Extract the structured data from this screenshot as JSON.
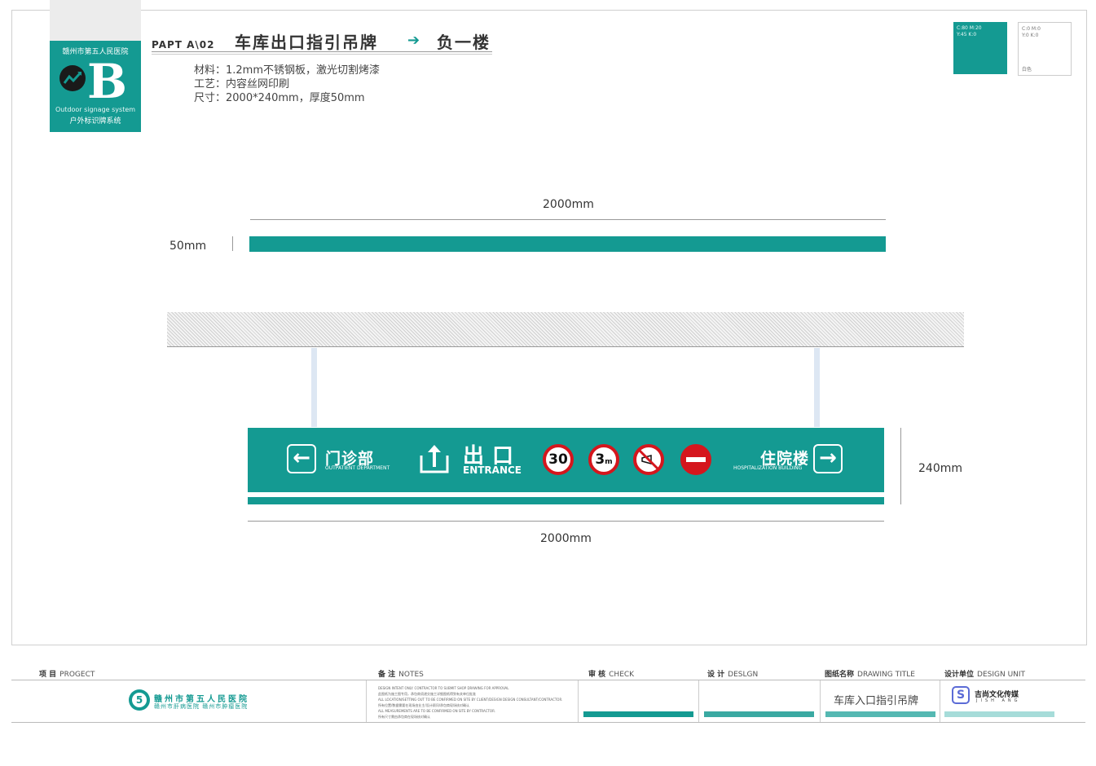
{
  "logo": {
    "hospital": "赣州市第五人民医院",
    "letter": "B",
    "system_en": "Outdoor signage system",
    "system_cn": "户外标识牌系统"
  },
  "header": {
    "part": "PAPT  A\\02",
    "title": "车库出口指引吊牌",
    "floor": "负一楼",
    "specs": [
      "材料：1.2mm不锈钢板，激光切割烤漆",
      "工艺：内容丝网印刷",
      "尺寸：2000*240mm，厚度50mm"
    ]
  },
  "swatches": {
    "teal_text": "C:80 M:20\nY:45 K:0",
    "white_text": "C:0 M:0\nY:0 K:0",
    "white_name": "白色",
    "teal_color": "#149a92"
  },
  "dimensions": {
    "top_width": "2000mm",
    "thickness": "50mm",
    "height": "240mm",
    "bottom_width": "2000mm"
  },
  "sign": {
    "left_cn": "门诊部",
    "left_en": "OUTPATIENT DEPARTMENT",
    "center_cn": "出口",
    "center_en": "ENTRANCE",
    "speed": "30",
    "height_limit": "3",
    "height_unit": "m",
    "right_cn": "住院楼",
    "right_en": "HOSPITALIZATION BUILDING"
  },
  "footer": {
    "project": {
      "cn": "项 目",
      "en": "PROGECT"
    },
    "notes": {
      "cn": "备 注",
      "en": "NOTES"
    },
    "check": {
      "cn": "审 核",
      "en": "CHECK"
    },
    "design": {
      "cn": "设 计",
      "en": "DESLGN"
    },
    "drawing_title": {
      "cn": "图纸名称",
      "en": "DRAWING TITLE"
    },
    "design_unit": {
      "cn": "设计单位",
      "en": "DESIGN UNIT"
    },
    "project_name": "赣州市第五人民医院",
    "project_sub": "赣州市肝病医院  赣州市肿瘤医院",
    "drawing_name": "车库入口指引吊牌",
    "company_cn": "吉尚文化传媒",
    "company_en": "JISH ANG",
    "notes_lines": [
      "DESIGN INTENT ONLY. CONTRACTOR TO SUBMIT SHOP DRAWING FOR APPROVAL",
      "此图纸为施工图专用，承包商须递交施工详细图纸得到有关单位批准",
      "ALL LOCATION/SETTING OUT TO BE CONFIRMED ON SITE BY CLIENT/DESIGN DESIGN CONSULTANT/CONTRACTOR.",
      "所有位置/数据需要在现场由业主/设计顾问/承包商现场核对确认",
      "ALL MEASUREMENTS ARE TO BE CONFIRMED ON SITE BY CONTRACTOR.",
      "所有尺寸需由承包商在现场核对确认"
    ]
  }
}
